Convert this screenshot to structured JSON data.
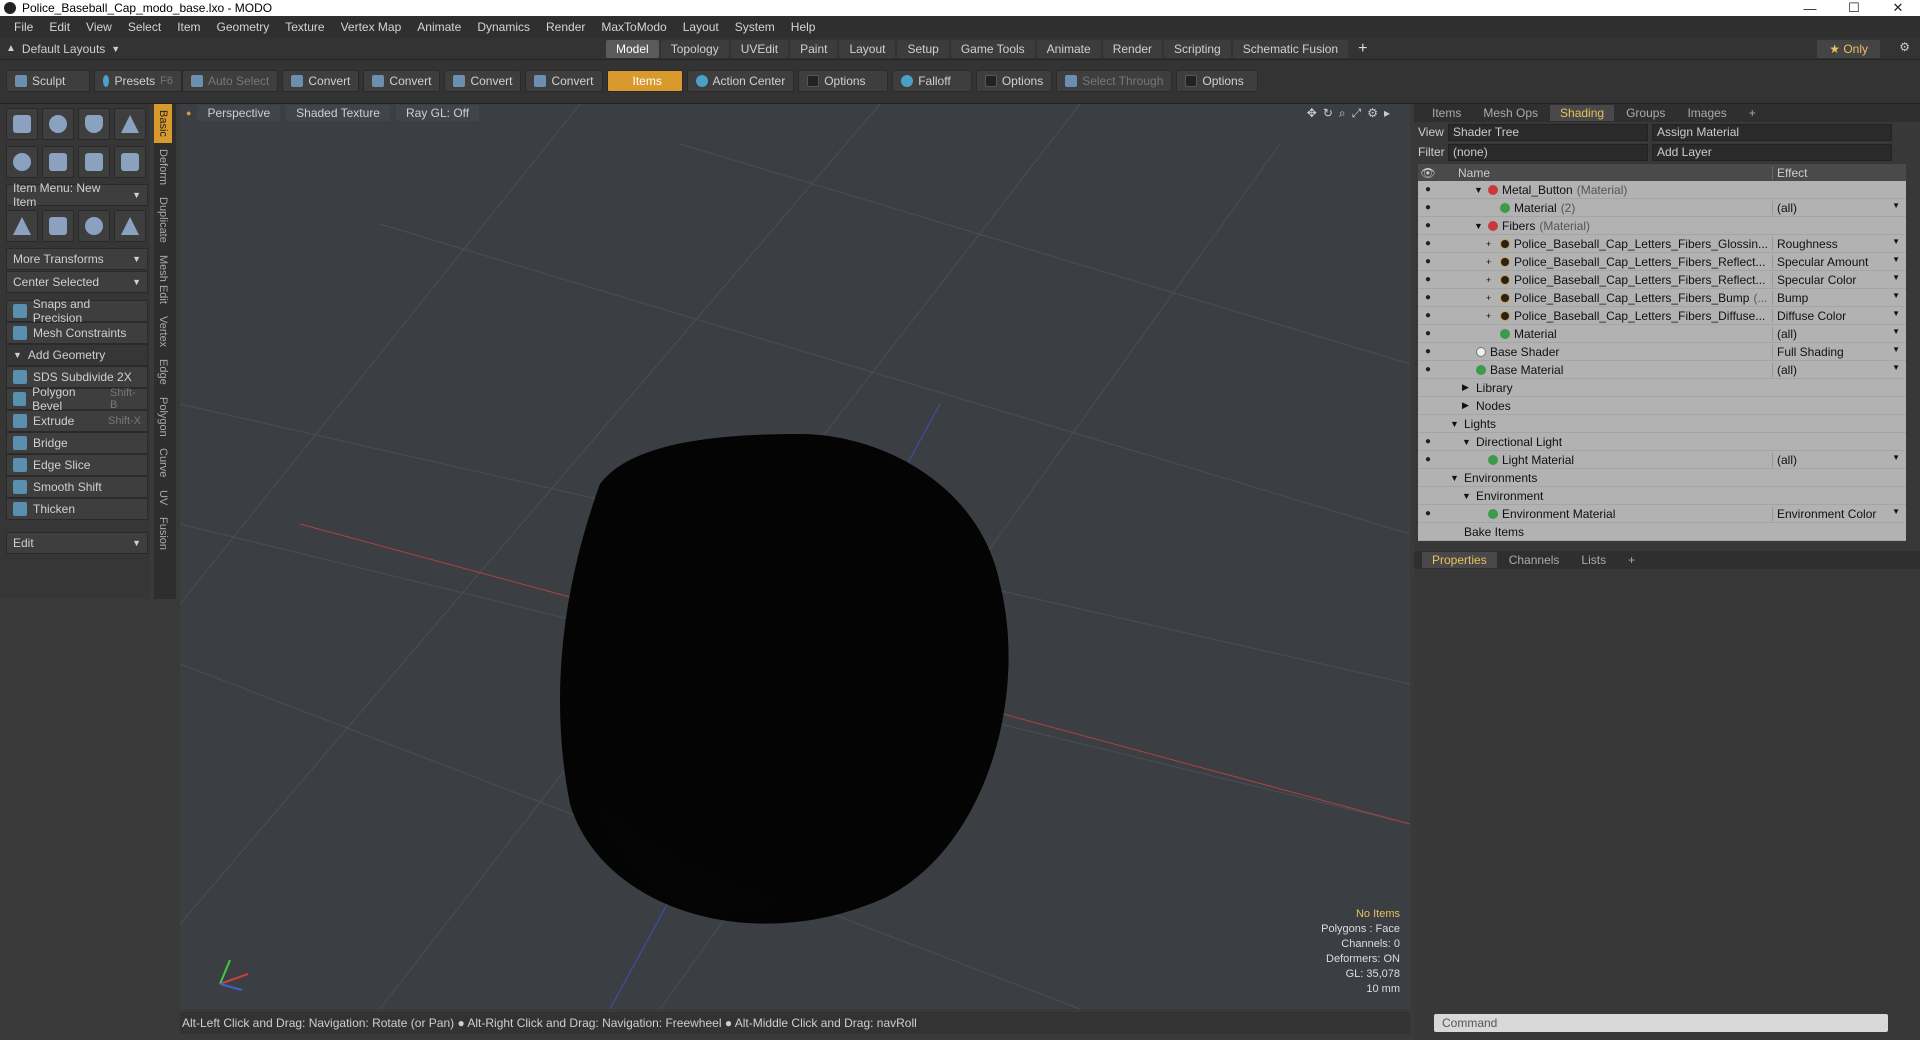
{
  "window": {
    "title": "Police_Baseball_Cap_modo_base.lxo - MODO",
    "minimize": "—",
    "maximize": "☐",
    "close": "✕"
  },
  "menu": [
    "File",
    "Edit",
    "View",
    "Select",
    "Item",
    "Geometry",
    "Texture",
    "Vertex Map",
    "Animate",
    "Dynamics",
    "Render",
    "MaxToModo",
    "Layout",
    "System",
    "Help"
  ],
  "layoutbar": {
    "layouts": "Default Layouts",
    "tabs": [
      "Model",
      "Topology",
      "UVEdit",
      "Paint",
      "Layout",
      "Setup",
      "Game Tools",
      "Animate",
      "Render",
      "Scripting",
      "Schematic Fusion"
    ],
    "active_tab": "Model",
    "plus": "+",
    "only": "★  Only",
    "gear": "⚙"
  },
  "toolbar": {
    "sculpt": "Sculpt",
    "presets": "Presets",
    "presets_key": "F6",
    "auto_select": "Auto Select",
    "convert": "Convert",
    "items": "Items",
    "action_center": "Action Center",
    "options": "Options",
    "falloff": "Falloff",
    "select_through": "Select Through"
  },
  "left": {
    "item_menu": "Item Menu: New Item",
    "more_transforms": "More Transforms",
    "center_selected": "Center Selected",
    "snaps": "Snaps and Precision",
    "mesh_constraints": "Mesh Constraints",
    "add_geometry": "Add Geometry",
    "tools": [
      {
        "label": "SDS Subdivide 2X",
        "key": ""
      },
      {
        "label": "Polygon Bevel",
        "key": "Shift-B"
      },
      {
        "label": "Extrude",
        "key": "Shift-X"
      },
      {
        "label": "Bridge",
        "key": ""
      },
      {
        "label": "Edge Slice",
        "key": ""
      },
      {
        "label": "Smooth Shift",
        "key": ""
      },
      {
        "label": "Thicken",
        "key": ""
      }
    ],
    "edit": "Edit",
    "sidetabs": [
      "Basic",
      "Deform",
      "Duplicate",
      "Mesh Edit",
      "Vertex",
      "Edge",
      "Polygon",
      "Curve",
      "UV",
      "Fusion"
    ]
  },
  "viewport": {
    "perspective": "Perspective",
    "shaded_texture": "Shaded Texture",
    "raygl": "Ray GL: Off",
    "stats": [
      "No Items",
      "Polygons : Face",
      "Channels: 0",
      "Deformers: ON",
      "GL: 35,078",
      "10 mm"
    ]
  },
  "status": "Alt-Left Click and Drag: Navigation: Rotate (or Pan) ● Alt-Right Click and Drag: Navigation: Freewheel ● Alt-Middle Click and Drag: navRoll",
  "right": {
    "tabs": [
      "Items",
      "Mesh Ops",
      "Shading",
      "Groups",
      "Images"
    ],
    "active": "Shading",
    "view_label": "View",
    "view_value": "Shader Tree",
    "assign_material": "Assign Material",
    "filter_label": "Filter",
    "filter_value": "(none)",
    "add_layer": "Add Layer",
    "col_name": "Name",
    "col_effect": "Effect",
    "tree": [
      {
        "indent": 3,
        "dot": "red",
        "name": "Metal_Button",
        "sub": " (Material)",
        "effect": "",
        "eye": true,
        "exp": "▼"
      },
      {
        "indent": 4,
        "dot": "green",
        "name": "Material",
        "sub": " (2)",
        "effect": "(all)",
        "eye": true,
        "exp": ""
      },
      {
        "indent": 3,
        "dot": "red",
        "name": "Fibers",
        "sub": " (Material)",
        "effect": "",
        "eye": true,
        "exp": "▼"
      },
      {
        "indent": 4,
        "dot": "blk",
        "name": "Police_Baseball_Cap_Letters_Fibers_Glossin...",
        "sub": "",
        "effect": "Roughness",
        "eye": true,
        "exp": "+"
      },
      {
        "indent": 4,
        "dot": "blk",
        "name": "Police_Baseball_Cap_Letters_Fibers_Reflect...",
        "sub": "",
        "effect": "Specular Amount",
        "eye": true,
        "exp": "+"
      },
      {
        "indent": 4,
        "dot": "blk",
        "name": "Police_Baseball_Cap_Letters_Fibers_Reflect...",
        "sub": "",
        "effect": "Specular Color",
        "eye": true,
        "exp": "+"
      },
      {
        "indent": 4,
        "dot": "blk",
        "name": "Police_Baseball_Cap_Letters_Fibers_Bump",
        "sub": " (...",
        "effect": "Bump",
        "eye": true,
        "exp": "+"
      },
      {
        "indent": 4,
        "dot": "blk",
        "name": "Police_Baseball_Cap_Letters_Fibers_Diffuse...",
        "sub": "",
        "effect": "Diffuse Color",
        "eye": true,
        "exp": "+"
      },
      {
        "indent": 4,
        "dot": "green",
        "name": "Material",
        "sub": "",
        "effect": "(all)",
        "eye": true,
        "exp": ""
      },
      {
        "indent": 2,
        "dot": "wht",
        "name": "Base Shader",
        "sub": "",
        "effect": "Full Shading",
        "eye": true,
        "exp": ""
      },
      {
        "indent": 2,
        "dot": "green",
        "name": "Base Material",
        "sub": "",
        "effect": "(all)",
        "eye": true,
        "exp": ""
      },
      {
        "indent": 2,
        "dot": "",
        "name": "Library",
        "sub": "",
        "effect": "",
        "eye": false,
        "exp": "▶"
      },
      {
        "indent": 2,
        "dot": "",
        "name": "Nodes",
        "sub": "",
        "effect": "",
        "eye": false,
        "exp": "▶"
      },
      {
        "indent": 1,
        "dot": "",
        "name": "Lights",
        "sub": "",
        "effect": "",
        "eye": false,
        "exp": "▼"
      },
      {
        "indent": 2,
        "dot": "",
        "name": "Directional Light",
        "sub": "",
        "effect": "",
        "eye": true,
        "exp": "▼"
      },
      {
        "indent": 3,
        "dot": "green",
        "name": "Light Material",
        "sub": "",
        "effect": "(all)",
        "eye": true,
        "exp": ""
      },
      {
        "indent": 1,
        "dot": "",
        "name": "Environments",
        "sub": "",
        "effect": "",
        "eye": false,
        "exp": "▼"
      },
      {
        "indent": 2,
        "dot": "",
        "name": "Environment",
        "sub": "",
        "effect": "",
        "eye": false,
        "exp": "▼"
      },
      {
        "indent": 3,
        "dot": "green",
        "name": "Environment Material",
        "sub": "",
        "effect": "Environment Color",
        "eye": true,
        "exp": ""
      },
      {
        "indent": 1,
        "dot": "",
        "name": "Bake Items",
        "sub": "",
        "effect": "",
        "eye": false,
        "exp": ""
      }
    ],
    "prop_tabs": [
      "Properties",
      "Channels",
      "Lists"
    ],
    "prop_active": "Properties",
    "command": "Command"
  }
}
